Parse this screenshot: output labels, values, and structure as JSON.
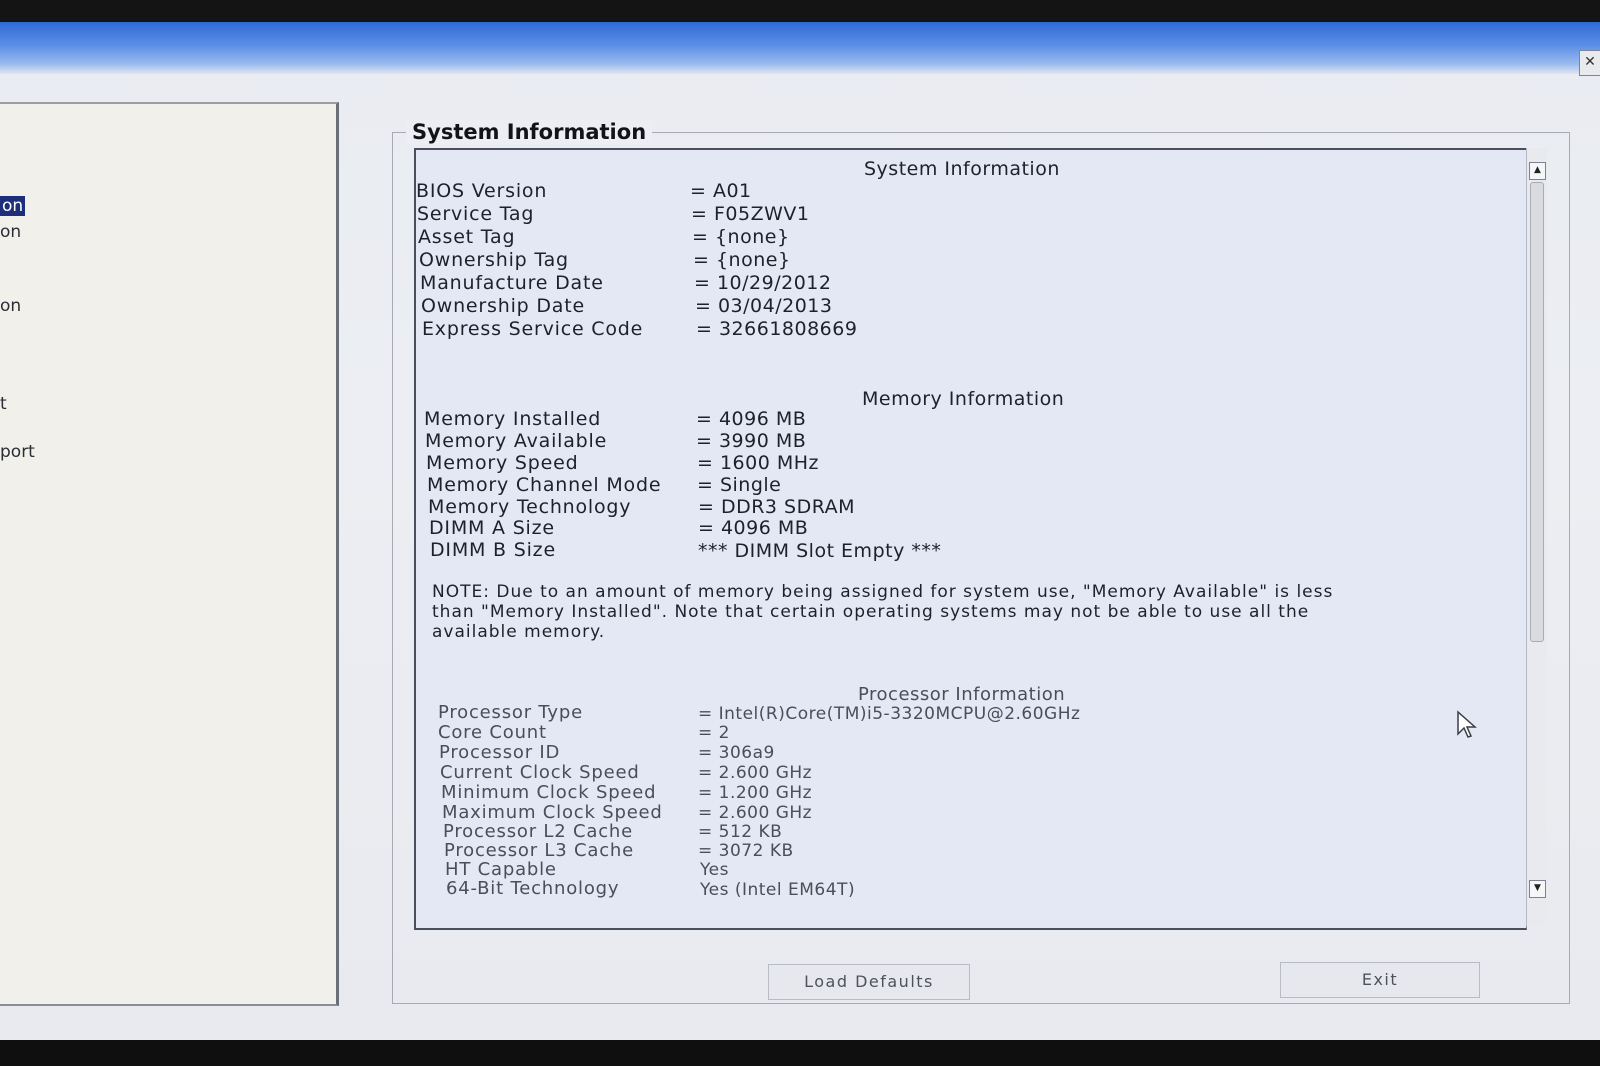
{
  "window": {
    "close_label": "✕"
  },
  "nav": {
    "items": [
      {
        "label": "on",
        "selected": true
      },
      {
        "label": "on",
        "selected": false
      },
      {
        "label": "on",
        "selected": false
      },
      {
        "label": "t",
        "selected": false
      },
      {
        "label": "port",
        "selected": false
      }
    ]
  },
  "group": {
    "title": "System Information"
  },
  "system_section": {
    "title": "System Information",
    "rows": [
      {
        "label": "BIOS Version",
        "value": "= A01"
      },
      {
        "label": "Service Tag",
        "value": "= F05ZWV1"
      },
      {
        "label": "Asset Tag",
        "value": "= {none}"
      },
      {
        "label": "Ownership Tag",
        "value": "= {none}"
      },
      {
        "label": "Manufacture Date",
        "value": "= 10/29/2012"
      },
      {
        "label": "Ownership Date",
        "value": "= 03/04/2013"
      },
      {
        "label": "Express Service Code",
        "value": "= 32661808669"
      }
    ]
  },
  "memory_section": {
    "title": "Memory Information",
    "rows": [
      {
        "label": "Memory Installed",
        "value": "= 4096 MB"
      },
      {
        "label": "Memory Available",
        "value": "= 3990 MB"
      },
      {
        "label": "Memory Speed",
        "value": "= 1600 MHz"
      },
      {
        "label": "Memory Channel Mode",
        "value": "= Single"
      },
      {
        "label": "Memory Technology",
        "value": "= DDR3 SDRAM"
      },
      {
        "label": "DIMM A Size",
        "value": "= 4096 MB"
      },
      {
        "label": "DIMM B Size",
        "value": "*** DIMM Slot Empty ***"
      }
    ],
    "note_line1": "NOTE: Due to an amount of memory being assigned for system use, \"Memory Available\" is less",
    "note_line2": "than \"Memory Installed\". Note that certain operating systems may not be able to use all the",
    "note_line3": "available memory."
  },
  "processor_section": {
    "title": "Processor Information",
    "rows": [
      {
        "label": "Processor Type",
        "value": "= Intel(R)Core(TM)i5-3320MCPU@2.60GHz"
      },
      {
        "label": "Core Count",
        "value": "= 2"
      },
      {
        "label": "Processor ID",
        "value": "= 306a9"
      },
      {
        "label": "Current Clock Speed",
        "value": "= 2.600 GHz"
      },
      {
        "label": "Minimum Clock Speed",
        "value": "= 1.200 GHz"
      },
      {
        "label": "Maximum Clock Speed",
        "value": "= 2.600 GHz"
      },
      {
        "label": "Processor L2 Cache",
        "value": "= 512 KB"
      },
      {
        "label": "Processor L3 Cache",
        "value": "= 3072 KB"
      },
      {
        "label": "HT Capable",
        "value": "Yes"
      },
      {
        "label": "64-Bit Technology",
        "value": "Yes (Intel EM64T)"
      }
    ]
  },
  "buttons": {
    "load_defaults": "Load Defaults",
    "exit": "Exit"
  }
}
